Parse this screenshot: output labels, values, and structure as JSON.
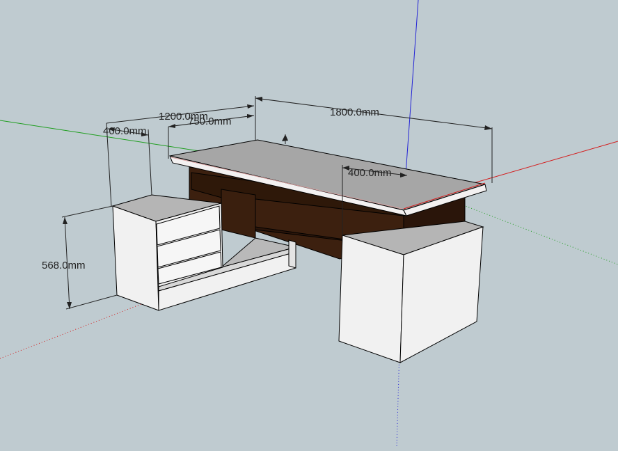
{
  "viewport": {
    "background": "#bfcbd0",
    "axis_colors": {
      "red": "#d41c1c",
      "green": "#1e9e1e",
      "blue": "#2323d6"
    }
  },
  "model": {
    "colors": {
      "top_surface": "#a6a6a6",
      "edge_band": "#f3f1f1",
      "wood": "#3c200f",
      "wood_dark": "#2a150a",
      "panel": "#f1f1f1",
      "panel_shade": "#e4e4e4",
      "cabinet_top": "#b5b5b5"
    }
  },
  "dimensions": {
    "desk_length": "1800.0mm",
    "return_length": "1200.0mm",
    "return_inner": "750.0mm",
    "return_depth": "400.0mm",
    "pedestal_depth": "400.0mm",
    "cabinet_height": "568.0mm"
  }
}
